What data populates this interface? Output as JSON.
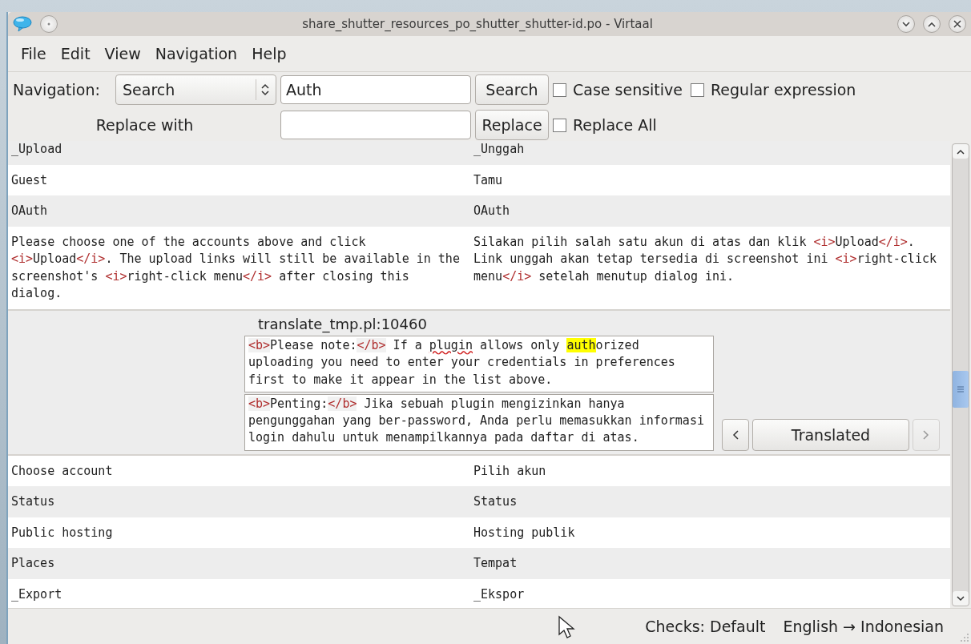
{
  "window": {
    "title": "share_shutter_resources_po_shutter_shutter-id.po - Virtaal"
  },
  "menu": [
    {
      "label": "File"
    },
    {
      "label": "Edit"
    },
    {
      "label": "View"
    },
    {
      "label": "Navigation"
    },
    {
      "label": "Help"
    }
  ],
  "search_bar": {
    "navigation_label": {
      "label": "Navigation:"
    },
    "mode": "Search",
    "search_value": "Auth",
    "search_button": "Search",
    "options": [
      {
        "label": "Case sensitive",
        "checked": false
      },
      {
        "label": "Regular expression",
        "checked": false
      }
    ],
    "replace_label": "Replace with",
    "replace_button": "Replace",
    "replace_all": {
      "label": "Replace All",
      "checked": false
    }
  },
  "rows": [
    {
      "kind": "unit",
      "source": [
        {
          "kind": "text",
          "text": "_Upload"
        }
      ],
      "target": [
        {
          "kind": "text",
          "text": "_Unggah"
        }
      ]
    },
    {
      "kind": "unit",
      "source": [
        {
          "kind": "text",
          "text": "Guest"
        }
      ],
      "target": [
        {
          "kind": "text",
          "text": "Tamu"
        }
      ]
    },
    {
      "kind": "unit",
      "source": [
        {
          "kind": "text",
          "text": "OAuth"
        }
      ],
      "target": [
        {
          "kind": "text",
          "text": "OAuth"
        }
      ]
    },
    {
      "kind": "unit",
      "source": [
        {
          "kind": "text",
          "text": "Please choose one of the accounts above and click "
        },
        {
          "kind": "tag",
          "text": "<i>"
        },
        {
          "kind": "text",
          "text": "Upload"
        },
        {
          "kind": "tag",
          "text": "</i>"
        },
        {
          "kind": "text",
          "text": ". The upload links will still be available in the screenshot's "
        },
        {
          "kind": "tag",
          "text": "<i>"
        },
        {
          "kind": "text",
          "text": "right-click menu"
        },
        {
          "kind": "tag",
          "text": "</i>"
        },
        {
          "kind": "text",
          "text": " after closing this dialog."
        }
      ],
      "target": [
        {
          "kind": "text",
          "text": "Silakan pilih salah satu akun di atas dan klik "
        },
        {
          "kind": "tag",
          "text": "<i>"
        },
        {
          "kind": "text",
          "text": "Upload"
        },
        {
          "kind": "tag",
          "text": "</i>"
        },
        {
          "kind": "text",
          "text": ". Link unggah akan tetap tersedia di screenshot ini "
        },
        {
          "kind": "tag",
          "text": "<i>"
        },
        {
          "kind": "text",
          "text": "right-click menu"
        },
        {
          "kind": "tag",
          "text": "</i>"
        },
        {
          "kind": "text",
          "text": " setelah menutup dialog ini."
        }
      ]
    },
    {
      "kind": "editor",
      "location": "translate_tmp.pl:10460",
      "source": [
        {
          "kind": "tag",
          "text": "<b>"
        },
        {
          "kind": "text",
          "text": "Please note:"
        },
        {
          "kind": "tag",
          "text": "</b>"
        },
        {
          "kind": "text",
          "text": " If a "
        },
        {
          "kind": "misspelled",
          "text": "plugin"
        },
        {
          "kind": "text",
          "text": " allows only "
        },
        {
          "kind": "match",
          "text": "auth"
        },
        {
          "kind": "text",
          "text": "orized uploading you need to enter your credentials in preferences first to make it appear in the list above."
        }
      ],
      "target": [
        {
          "kind": "tag",
          "text": "<b>"
        },
        {
          "kind": "text",
          "text": "Penting:"
        },
        {
          "kind": "tag",
          "text": "</b>"
        },
        {
          "kind": "text",
          "text": " Jika sebuah plugin mengizinkan hanya pengunggahan yang ber-password, Anda perlu memasukkan informasi login dahulu untuk menampilkannya pada daftar di atas."
        }
      ],
      "status": "Translated",
      "previous_disabled": false,
      "next_disabled": true
    },
    {
      "kind": "unit",
      "source": [
        {
          "kind": "text",
          "text": "Choose account"
        }
      ],
      "target": [
        {
          "kind": "text",
          "text": "Pilih akun"
        }
      ]
    },
    {
      "kind": "unit",
      "source": [
        {
          "kind": "text",
          "text": "Status"
        }
      ],
      "target": [
        {
          "kind": "text",
          "text": "Status"
        }
      ]
    },
    {
      "kind": "unit",
      "source": [
        {
          "kind": "text",
          "text": "Public hosting"
        }
      ],
      "target": [
        {
          "kind": "text",
          "text": "Hosting publik"
        }
      ]
    },
    {
      "kind": "unit",
      "source": [
        {
          "kind": "text",
          "text": "Places"
        }
      ],
      "target": [
        {
          "kind": "text",
          "text": "Tempat"
        }
      ]
    },
    {
      "kind": "unit",
      "source": [
        {
          "kind": "text",
          "text": "_Export"
        }
      ],
      "target": [
        {
          "kind": "text",
          "text": "_Ekspor"
        }
      ]
    }
  ],
  "status_bar": {
    "checks": "Checks: Default",
    "languages": "English → Indonesian"
  }
}
